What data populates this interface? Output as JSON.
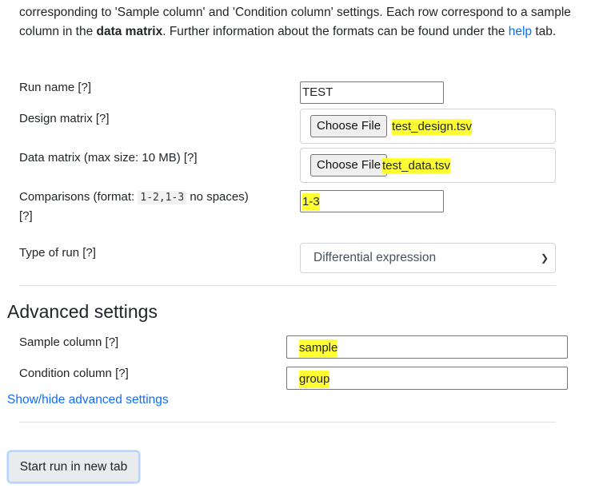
{
  "intro": {
    "text1": "corresponding to 'Sample column' and 'Condition column' settings. Each row correspond to a sample column in the ",
    "bold": "data matrix",
    "text2": ". Further information about the formats can be found under the ",
    "help_link": "help",
    "text3": " tab."
  },
  "form": {
    "run_name": {
      "label": "Run name [?]",
      "value": "TEST"
    },
    "design_matrix": {
      "label": "Design matrix [?]",
      "button": "Choose File",
      "file": "test_design.tsv"
    },
    "data_matrix": {
      "label": "Data matrix (max size: 10 MB) [?]",
      "button": "Choose File",
      "file": "test_data.tsv"
    },
    "comparisons": {
      "label_pre": "Comparisons (format: ",
      "code": "1-2,1-3",
      "label_post": " no spaces)",
      "label_help": "[?]",
      "value": "1-3"
    },
    "run_type": {
      "label": "Type of run [?]",
      "value": "Differential expression"
    }
  },
  "advanced": {
    "title": "Advanced settings",
    "sample_column": {
      "label": "Sample column [?]",
      "value": "sample"
    },
    "condition_column": {
      "label": "Condition column [?]",
      "value": "group"
    },
    "toggle_link": "Show/hide advanced settings"
  },
  "actions": {
    "start_run": "Start run in new tab"
  },
  "colors": {
    "link": "#0d6efd",
    "highlight": "#ffff33"
  }
}
